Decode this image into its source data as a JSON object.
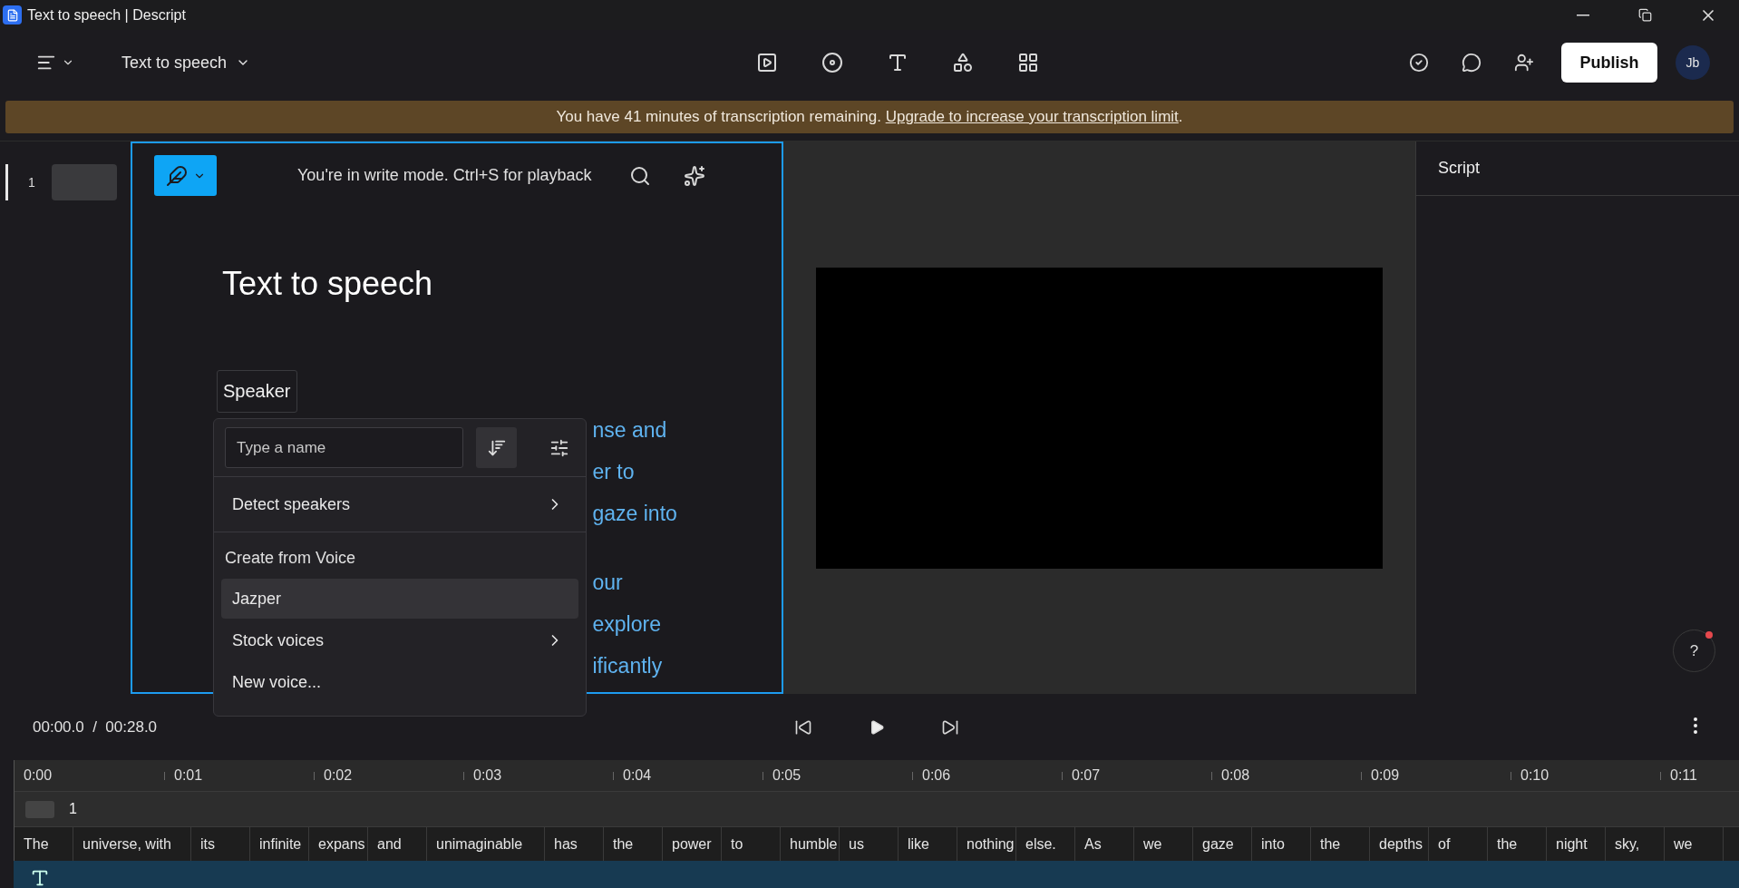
{
  "window": {
    "title": "Text to speech | Descript"
  },
  "toolbar": {
    "project_title": "Text to speech",
    "publish": "Publish",
    "avatar": "Jb"
  },
  "banner": {
    "text": "You have 41 minutes of transcription remaining. ",
    "link": "Upgrade to increase your transcription limit",
    "end": "."
  },
  "scenes": [
    {
      "label": "1",
      "selected": true
    }
  ],
  "editor": {
    "mode_hint": "You're in write mode. Ctrl+S for playback",
    "heading": "Text to speech",
    "speaker": "Speaker",
    "paragraphs": [
      [
        "nse and",
        "er to",
        "gaze into"
      ],
      [
        "our",
        "explore",
        "ificantly"
      ]
    ]
  },
  "speaker_menu": {
    "placeholder": "Type a name",
    "sections": [
      {
        "items": [
          {
            "label": "Detect speakers",
            "submenu": true,
            "selected": false
          }
        ]
      },
      {
        "title": "Create from Voice",
        "items": [
          {
            "label": "Jazper",
            "submenu": false,
            "selected": true
          },
          {
            "label": "Stock voices",
            "submenu": true,
            "selected": false
          },
          {
            "label": "New voice...",
            "submenu": false,
            "selected": false
          }
        ]
      }
    ]
  },
  "script_panel": {
    "title": "Script",
    "help": "?"
  },
  "transport": {
    "current": "00:00.0",
    "separator": "/",
    "total": "00:28.0"
  },
  "timeline": {
    "ruler": [
      "0:00",
      "0:01",
      "0:02",
      "0:03",
      "0:04",
      "0:05",
      "0:06",
      "0:07",
      "0:08",
      "0:09",
      "0:10",
      "0:11"
    ],
    "track_label": "1",
    "words": [
      {
        "text": "The",
        "kind": "single"
      },
      {
        "text": "universe, with",
        "kind": "double"
      },
      {
        "text": "its",
        "kind": "single"
      },
      {
        "text": "infinite",
        "kind": "single"
      },
      {
        "text": "expans",
        "kind": "single"
      },
      {
        "text": "and",
        "kind": "single"
      },
      {
        "text": "unimaginable",
        "kind": "double"
      },
      {
        "text": "has",
        "kind": "single"
      },
      {
        "text": "the",
        "kind": "single"
      },
      {
        "text": "power",
        "kind": "single"
      },
      {
        "text": "to",
        "kind": "single"
      },
      {
        "text": "humble",
        "kind": "single"
      },
      {
        "text": "us",
        "kind": "single"
      },
      {
        "text": "like",
        "kind": "single"
      },
      {
        "text": "nothing",
        "kind": "single"
      },
      {
        "text": "else.",
        "kind": "single"
      },
      {
        "text": "As",
        "kind": "single"
      },
      {
        "text": "we",
        "kind": "single"
      },
      {
        "text": "gaze",
        "kind": "single"
      },
      {
        "text": "into",
        "kind": "single"
      },
      {
        "text": "the",
        "kind": "single"
      },
      {
        "text": "depths",
        "kind": "single"
      },
      {
        "text": "of",
        "kind": "single"
      },
      {
        "text": "the",
        "kind": "single"
      },
      {
        "text": "night",
        "kind": "single"
      },
      {
        "text": "sky,",
        "kind": "single"
      },
      {
        "text": "we",
        "kind": "single"
      }
    ]
  }
}
